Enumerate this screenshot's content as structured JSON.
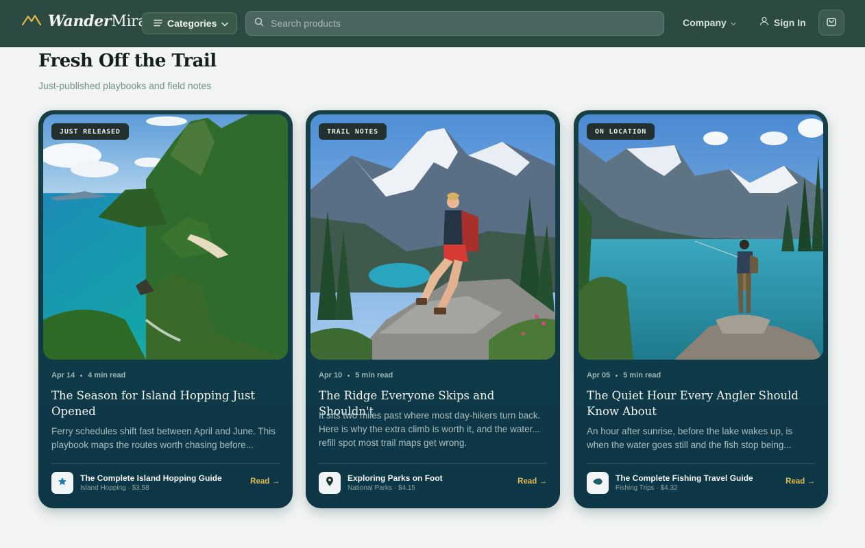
{
  "header": {
    "brand_bold": "Wander",
    "brand_light": "Mira",
    "categories_label": "Categories",
    "search_placeholder": "Search products",
    "company_label": "Company",
    "signin_label": "Sign In"
  },
  "section": {
    "title": "Fresh Off the Trail",
    "subtitle": "Just-published playbooks and field notes"
  },
  "cards": [
    {
      "badge": "JUST RELEASED",
      "date": "Apr 14",
      "read_time": "4 min read",
      "title": "The Season for Island Hopping Just Opened",
      "description": "Ferry schedules shift fast between April and June. This playbook maps the routes worth chasing before...",
      "guide_title": "The Complete Island Hopping Guide",
      "guide_meta": "Island Hopping · $3.58",
      "guide_icon": "star-icon",
      "read_label": "Read →"
    },
    {
      "badge": "TRAIL NOTES",
      "date": "Apr 10",
      "read_time": "5 min read",
      "title": "The Ridge Everyone Skips and Shouldn't",
      "description": "It sits two miles past where most day-hikers turn back. Here is why the extra climb is worth it, and the water... refill spot most trail maps get wrong.",
      "guide_title": "Exploring Parks on Foot",
      "guide_meta": "National Parks · $4.15",
      "guide_icon": "map-pin-icon",
      "read_label": "Read →"
    },
    {
      "badge": "ON LOCATION",
      "date": "Apr 05",
      "read_time": "5 min read",
      "title": "The Quiet Hour Every Angler Should Know About",
      "description": "An hour after sunrise, before the lake wakes up, is when the water goes still and the fish stop being...",
      "guide_title": "The Complete Fishing Travel Guide",
      "guide_meta": "Fishing Trips · $4.32",
      "guide_icon": "fish-icon",
      "read_label": "Read →"
    }
  ],
  "colors": {
    "header_bg": "#2c4a42",
    "card_bg": "#0f3a48",
    "accent": "#e0b94a",
    "page_bg": "#f1f4f3"
  }
}
